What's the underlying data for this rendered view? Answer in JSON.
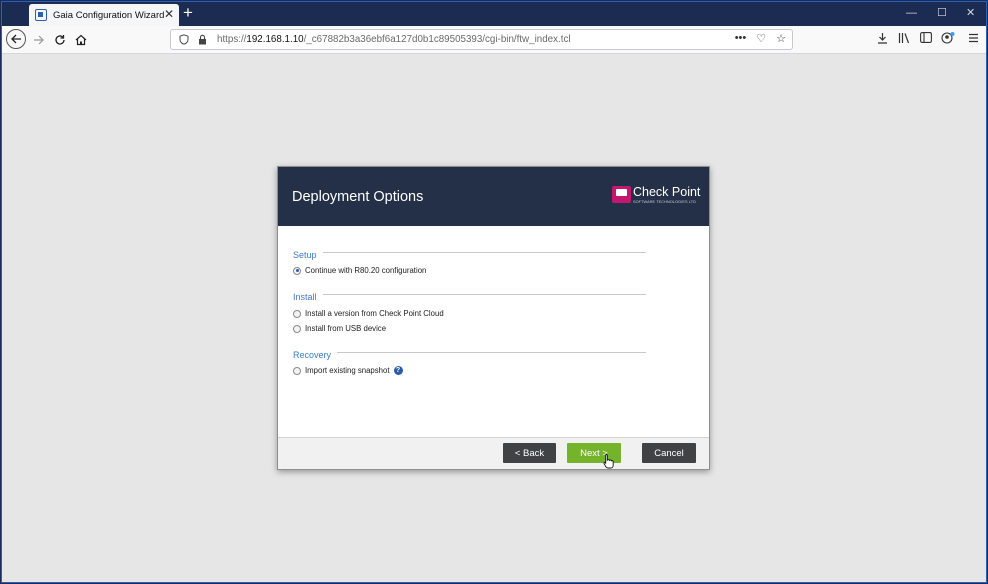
{
  "browser": {
    "tab_title": "Gaia Configuration Wizard",
    "tab_close": "✕",
    "new_tab": "+",
    "window_controls": {
      "minimize": "—",
      "maximize": "☐",
      "close": "✕"
    },
    "url": {
      "prefix": "https://",
      "host": "192.168.1.10",
      "path": "/_c67882b3a36ebf6a127d0b1c89505393/cgi-bin/ftw_index.tcl"
    },
    "url_actions": {
      "more": "•••",
      "pocket": "♡",
      "bookmark": "☆"
    }
  },
  "dialog": {
    "title": "Deployment Options",
    "logo": {
      "main": "Check Point",
      "sub": "SOFTWARE TECHNOLOGIES LTD"
    },
    "sections": [
      {
        "label": "Setup",
        "options": [
          {
            "label": "Continue with R80.20 configuration",
            "checked": true
          }
        ]
      },
      {
        "label": "Install",
        "options": [
          {
            "label": "Install a version from Check Point Cloud",
            "checked": false
          },
          {
            "label": "Install from USB device",
            "checked": false
          }
        ]
      },
      {
        "label": "Recovery",
        "options": [
          {
            "label": "Import existing snapshot",
            "checked": false,
            "help": "?"
          }
        ]
      }
    ],
    "buttons": {
      "back": "< Back",
      "next": "Next >",
      "cancel": "Cancel"
    }
  }
}
